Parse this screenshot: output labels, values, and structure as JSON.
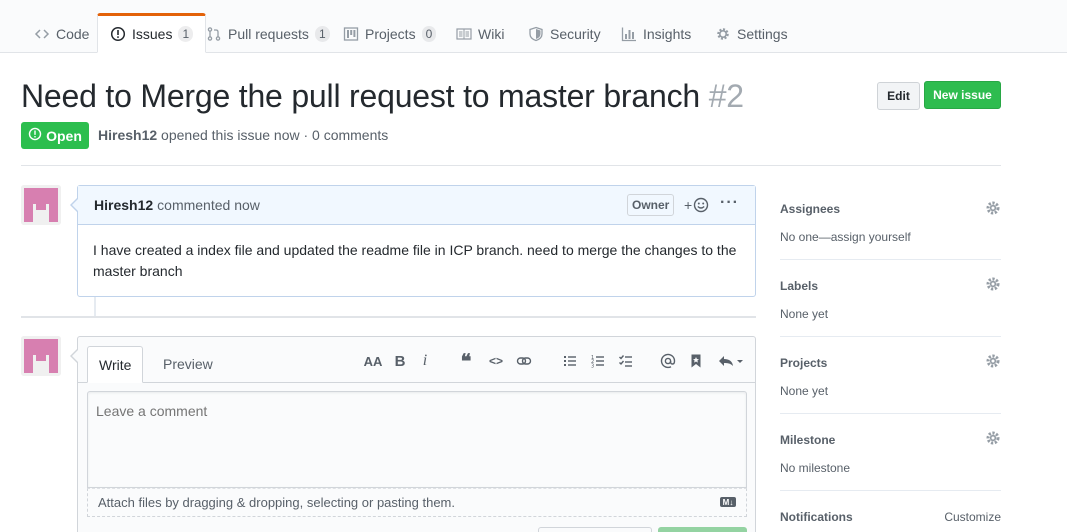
{
  "nav": {
    "tabs": [
      {
        "label": "Code",
        "count": null
      },
      {
        "label": "Issues",
        "count": "1"
      },
      {
        "label": "Pull requests",
        "count": "1"
      },
      {
        "label": "Projects",
        "count": "0"
      },
      {
        "label": "Wiki",
        "count": null
      },
      {
        "label": "Security",
        "count": null
      },
      {
        "label": "Insights",
        "count": null
      },
      {
        "label": "Settings",
        "count": null
      }
    ]
  },
  "issue": {
    "title": "Need to Merge the pull request to master branch",
    "number": "#2",
    "state": "Open",
    "author": "Hiresh12",
    "meta_text": "opened this issue now · 0 comments",
    "edit_label": "Edit",
    "new_issue_label": "New issue"
  },
  "comment": {
    "author": "Hiresh12",
    "time_text": "commented now",
    "badge": "Owner",
    "reaction_label": "+",
    "more_label": "···",
    "body": "I have created a index file and updated the readme file in ICP branch. need to merge the changes to the master branch"
  },
  "editor": {
    "write_tab": "Write",
    "preview_tab": "Preview",
    "placeholder": "Leave a comment",
    "attach_text": "Attach files by dragging & dropping, selecting or pasting them.",
    "tools": {
      "header": "AA",
      "bold": "B",
      "italic": "i",
      "quote": "❝",
      "code": "<>"
    },
    "md_badge": "M↓"
  },
  "sidebar": {
    "assignees": {
      "title": "Assignees",
      "value": "No one—assign yourself"
    },
    "labels": {
      "title": "Labels",
      "value": "None yet"
    },
    "projects": {
      "title": "Projects",
      "value": "None yet"
    },
    "milestone": {
      "title": "Milestone",
      "value": "No milestone"
    },
    "notifications": {
      "title": "Notifications",
      "action": "Customize"
    }
  },
  "colors": {
    "accent_tab": "#e36209",
    "open_green": "#2cbe4e",
    "new_issue_green": "#2ebc4f",
    "comment_border": "#c0d3eb"
  }
}
